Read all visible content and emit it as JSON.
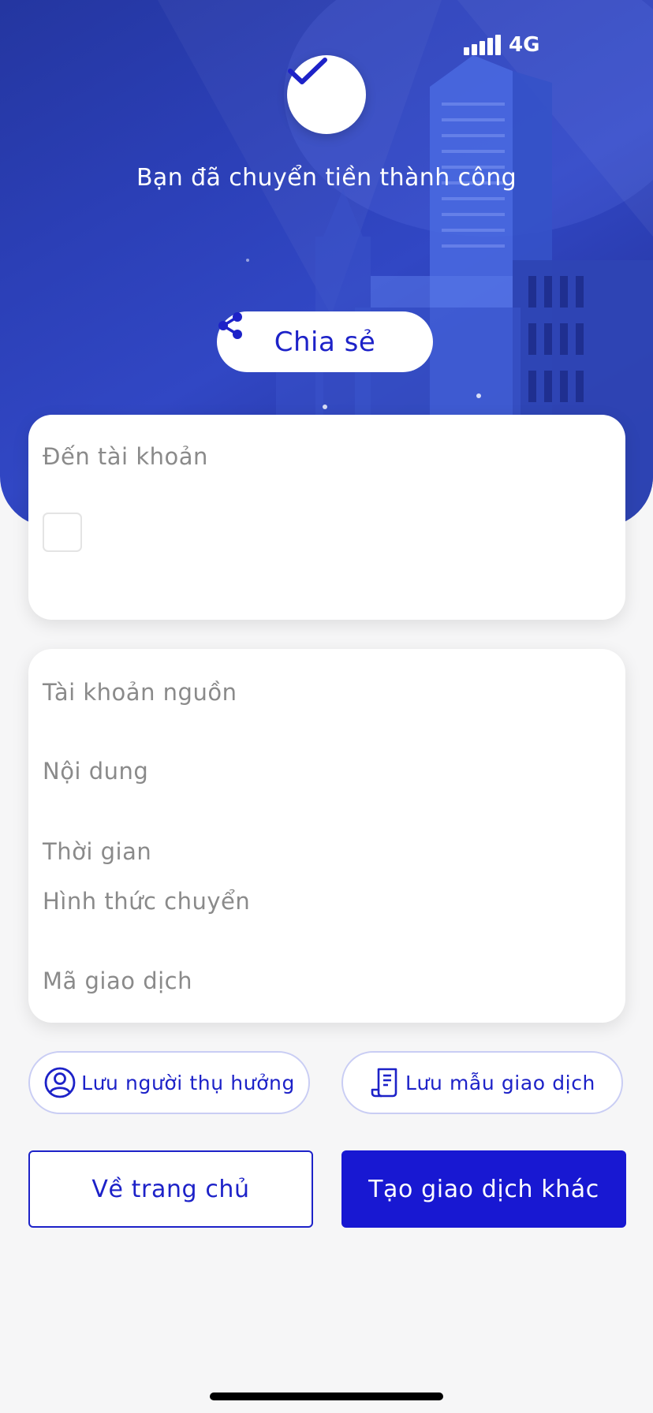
{
  "status_bar": {
    "network": "4G"
  },
  "header": {
    "success_message": "Bạn đã chuyển tiền thành công",
    "share_label": "Chia sẻ"
  },
  "recipient_card": {
    "to_account_label": "Đến tài khoản"
  },
  "details_card": {
    "fields": [
      {
        "label": "Tài khoản nguồn"
      },
      {
        "label": "Nội dung"
      },
      {
        "label": "Thời gian"
      },
      {
        "label": "Hình thức chuyển"
      },
      {
        "label": "Mã giao dịch"
      }
    ]
  },
  "actions": {
    "save_beneficiary": "Lưu người thụ hưởng",
    "save_template": "Lưu mẫu giao dịch",
    "home": "Về trang chủ",
    "new_transaction": "Tạo giao dịch khác"
  },
  "colors": {
    "accent": "#1d22c8",
    "primary_button": "#1818d2",
    "hero": "#2b3fb6"
  }
}
